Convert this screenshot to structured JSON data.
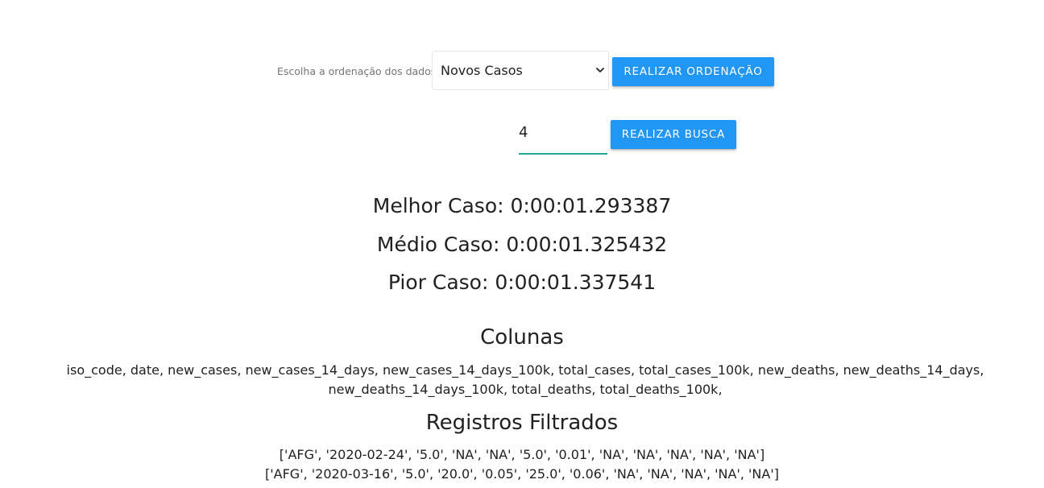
{
  "sort": {
    "label": "Escolha a ordenação dos dados:",
    "selected_option": "Novos Casos",
    "button_label": "REALIZAR ORDENAÇÃO"
  },
  "search": {
    "value": "4",
    "button_label": "REALIZAR BUSCA"
  },
  "results": {
    "best": "Melhor Caso: 0:00:01.293387",
    "average": "Médio Caso: 0:00:01.325432",
    "worst": "Pior Caso: 0:00:01.337541"
  },
  "columns": {
    "title": "Colunas",
    "list": "iso_code, date, new_cases, new_cases_14_days, new_cases_14_days_100k, total_cases, total_cases_100k, new_deaths, new_deaths_14_days, new_deaths_14_days_100k, total_deaths, total_deaths_100k,"
  },
  "records": {
    "title": "Registros Filtrados",
    "rows": [
      "['AFG', '2020-02-24', '5.0', 'NA', 'NA', '5.0', '0.01', 'NA', 'NA', 'NA', 'NA', 'NA']",
      "['AFG', '2020-03-16', '5.0', '20.0', '0.05', '25.0', '0.06', 'NA', 'NA', 'NA', 'NA', 'NA']"
    ]
  },
  "colors": {
    "primary_button": "#2196f3",
    "input_underline": "#26a69a"
  }
}
